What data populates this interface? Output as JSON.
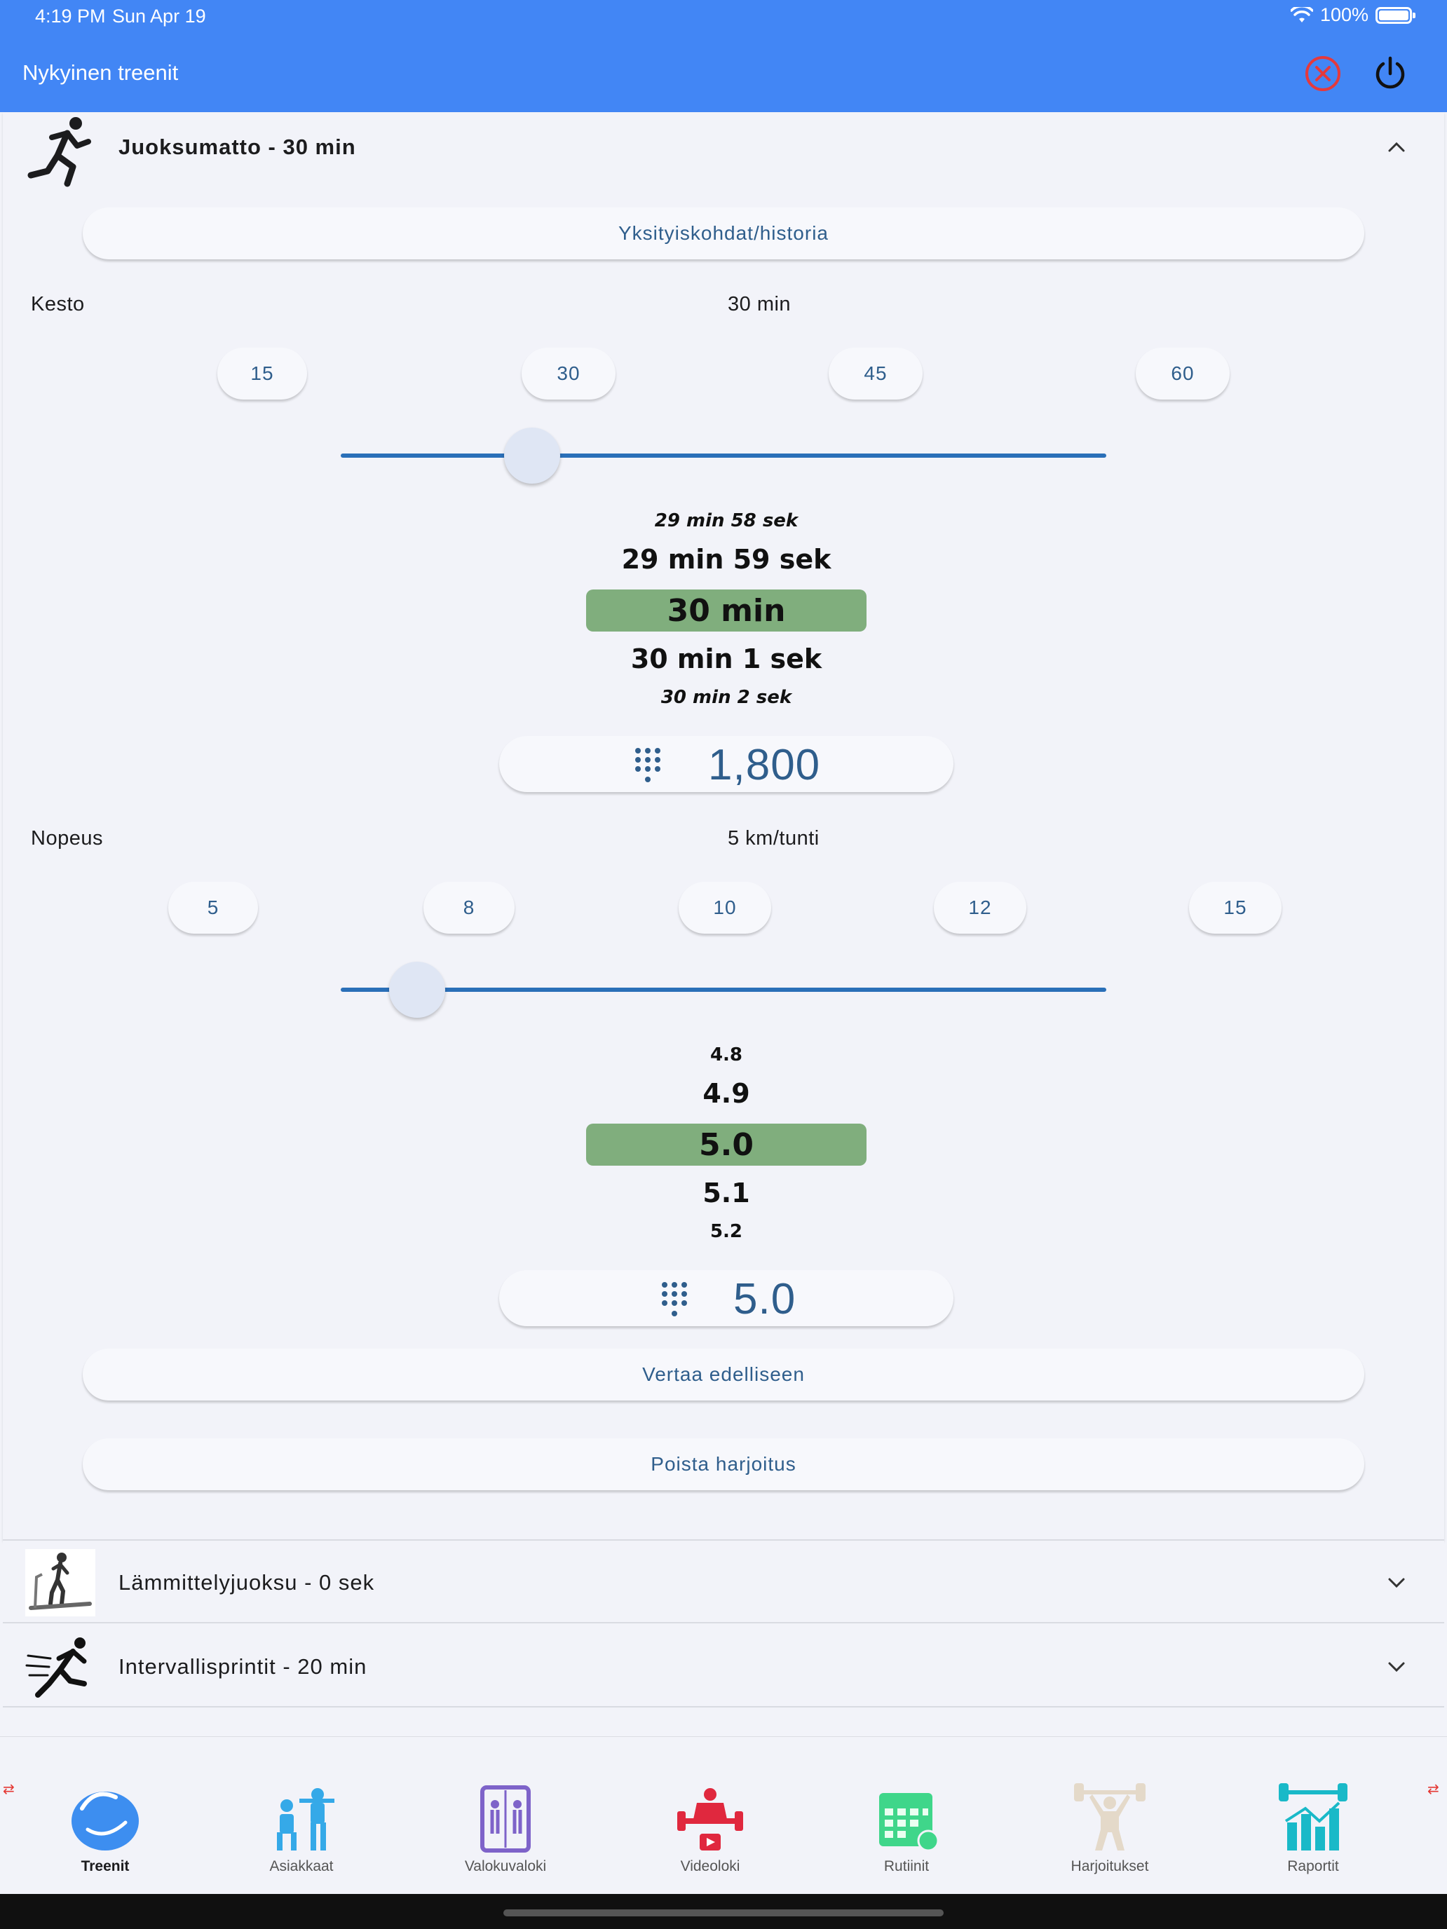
{
  "status_bar": {
    "time": "4:19 PM",
    "date": "Sun Apr 19",
    "battery": "100%"
  },
  "header": {
    "title": "Nykyinen treenit"
  },
  "exercise": {
    "title": "Juoksumatto - 30 min",
    "details_button": "Yksityiskohdat/historia",
    "duration": {
      "label": "Kesto",
      "value": "30 min",
      "presets": [
        "15",
        "30",
        "45",
        "60"
      ],
      "slider_fraction": 0.25,
      "wheel": [
        "29 min 58 sek",
        "29 min 59 sek",
        "30 min",
        "30 min 1 sek",
        "30 min 2 sek"
      ],
      "input_value": "1,800"
    },
    "speed": {
      "label": "Nopeus",
      "value": "5 km/tunti",
      "presets": [
        "5",
        "8",
        "10",
        "12",
        "15"
      ],
      "slider_fraction": 0.1,
      "wheel": [
        "4.8",
        "4.9",
        "5.0",
        "5.1",
        "5.2"
      ],
      "input_value": "5.0"
    },
    "compare_button": "Vertaa edelliseen",
    "delete_button": "Poista harjoitus"
  },
  "other_exercises": [
    {
      "title": "Lämmittelyjuoksu - 0 sek"
    },
    {
      "title": "Intervallisprintit - 20 min"
    }
  ],
  "nav": [
    {
      "label": "Treenit",
      "icon": "muscle-icon",
      "color": "#3d8ef0"
    },
    {
      "label": "Asiakkaat",
      "icon": "clients-icon",
      "color": "#35a9e8"
    },
    {
      "label": "Valokuvaloki",
      "icon": "photo-log-icon",
      "color": "#7e63c9"
    },
    {
      "label": "Videoloki",
      "icon": "video-log-icon",
      "color": "#e0283e"
    },
    {
      "label": "Rutiinit",
      "icon": "calendar-icon",
      "color": "#3fd68a"
    },
    {
      "label": "Harjoitukset",
      "icon": "weightlifter-icon",
      "color": "#e4d9c9"
    },
    {
      "label": "Raportit",
      "icon": "report-chart-icon",
      "color": "#19b9c8"
    }
  ],
  "colors": {
    "header": "#4286f5",
    "accent_text": "#2f5e8c",
    "wheel_highlight": "#80ae7d",
    "slider": "#2a6fb8"
  }
}
